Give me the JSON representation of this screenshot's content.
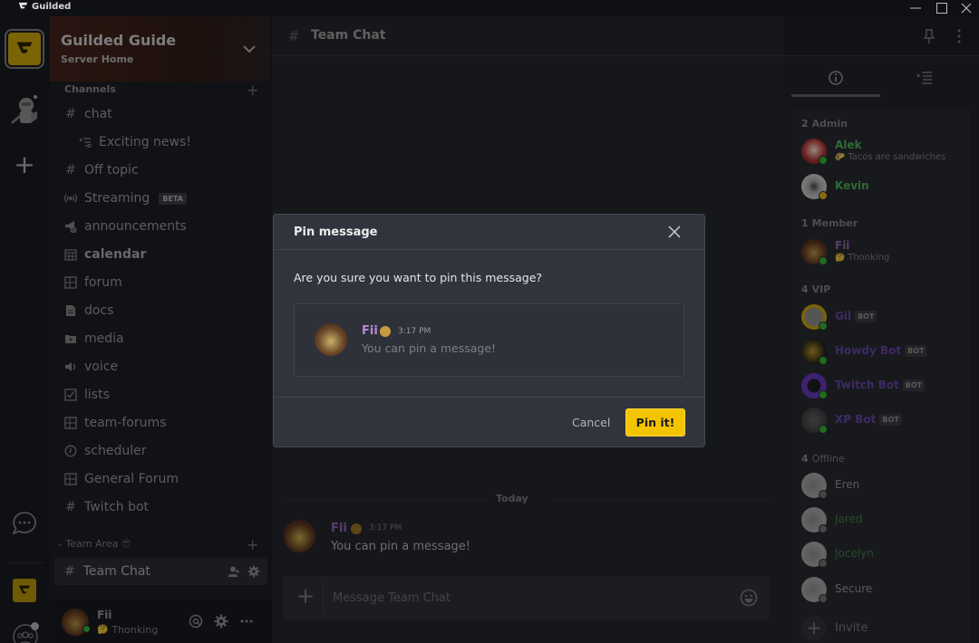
{
  "window": {
    "app_name": "Guilded",
    "controls": [
      "minimize-icon",
      "maximize-icon",
      "close-icon"
    ]
  },
  "rail": {
    "servers": [
      {
        "name": "Guilded Guide",
        "icon": "guilded-logo-icon",
        "active": true
      },
      {
        "name": "Knight server",
        "icon": "knight-icon"
      }
    ],
    "add_server": "plus-icon",
    "bottom": [
      "direct-messages-icon",
      "guilded-logo-icon",
      "community-icon"
    ]
  },
  "server": {
    "name": "Guilded Guide",
    "subtitle": "Server Home"
  },
  "channels": {
    "heading": "Channels",
    "items": [
      {
        "label": "chat",
        "icon": "hash-icon"
      },
      {
        "label": "Exciting news!",
        "icon": "thread-icon",
        "nested": true
      },
      {
        "label": "Off topic",
        "icon": "hash-icon"
      },
      {
        "label": "Streaming",
        "icon": "stream-icon",
        "badge": "BETA"
      },
      {
        "label": "announcements",
        "icon": "megaphone-icon"
      },
      {
        "label": "calendar",
        "icon": "calendar-icon",
        "bold": true
      },
      {
        "label": "forum",
        "icon": "forum-icon"
      },
      {
        "label": "docs",
        "icon": "doc-icon"
      },
      {
        "label": "media",
        "icon": "media-icon"
      },
      {
        "label": "voice",
        "icon": "voice-icon"
      },
      {
        "label": "lists",
        "icon": "checklist-icon"
      },
      {
        "label": "team-forums",
        "icon": "forum-icon"
      },
      {
        "label": "scheduler",
        "icon": "clock-icon"
      },
      {
        "label": "General Forum",
        "icon": "forum-icon"
      },
      {
        "label": "Twitch bot",
        "icon": "hash-icon"
      }
    ],
    "group": {
      "label": "Team Area",
      "emoji": "😎",
      "active_channel": "Team Chat"
    }
  },
  "current_user": {
    "name": "Fii",
    "status_emoji": "🤔",
    "status": "Thonking",
    "presence": "online"
  },
  "main": {
    "channel_title": "Team Chat",
    "divider_label": "Today",
    "messages": [
      {
        "author": "Fii",
        "emoji": "🤔",
        "time": "3:17 PM",
        "text": "You can pin a message!"
      }
    ],
    "composer": {
      "placeholder": "Message Team Chat",
      "value": ""
    }
  },
  "members_panel": {
    "tabs": [
      "info-icon",
      "outline-icon"
    ],
    "groups": [
      {
        "count": "2",
        "label": "Admin",
        "members": [
          {
            "name": "Alek",
            "status": "Tacos are sandwiches",
            "status_emoji": "🌮",
            "color": "#2f6a34",
            "presence": "online"
          },
          {
            "name": "Kevin",
            "color": "#2f6a34",
            "presence": "idle"
          }
        ]
      },
      {
        "count": "1",
        "label": "Member",
        "members": [
          {
            "name": "Fii",
            "status": "Thonking",
            "status_emoji": "🤔",
            "color": "#5a3e6b",
            "presence": "online"
          }
        ]
      },
      {
        "count": "4",
        "label": "VIP",
        "members": [
          {
            "name": "Gil",
            "badge": "BOT",
            "color": "#3d2a63",
            "presence": "online"
          },
          {
            "name": "Howdy Bot",
            "badge": "BOT",
            "color": "#3d2a63",
            "presence": "online"
          },
          {
            "name": "Twitch Bot",
            "badge": "BOT",
            "color": "#3d2a63",
            "presence": "online"
          },
          {
            "name": "XP Bot",
            "badge": "BOT",
            "color": "#3d2a63",
            "presence": "online"
          }
        ]
      },
      {
        "count": "4",
        "label": "Offline",
        "members": [
          {
            "name": "Eren",
            "color": "#5a5a5a",
            "presence": "offline"
          },
          {
            "name": "Jared",
            "color": "#2a4a2c",
            "presence": "offline"
          },
          {
            "name": "Jocelyn",
            "color": "#2a4a2c",
            "presence": "offline"
          },
          {
            "name": "Secure",
            "color": "#5a5a5a",
            "presence": "offline"
          }
        ]
      }
    ],
    "invite_label": "Invite"
  },
  "modal": {
    "title": "Pin message",
    "question": "Are you sure you want to pin this message?",
    "preview": {
      "author": "Fii",
      "emoji": "🤔",
      "time": "3:17 PM",
      "text": "You can pin a message!"
    },
    "cancel_label": "Cancel",
    "confirm_label": "Pin it!"
  },
  "colors": {
    "accent": "#f5c400",
    "online": "#1f6b1f",
    "idle": "#8a6a10",
    "offline": "#555555"
  }
}
